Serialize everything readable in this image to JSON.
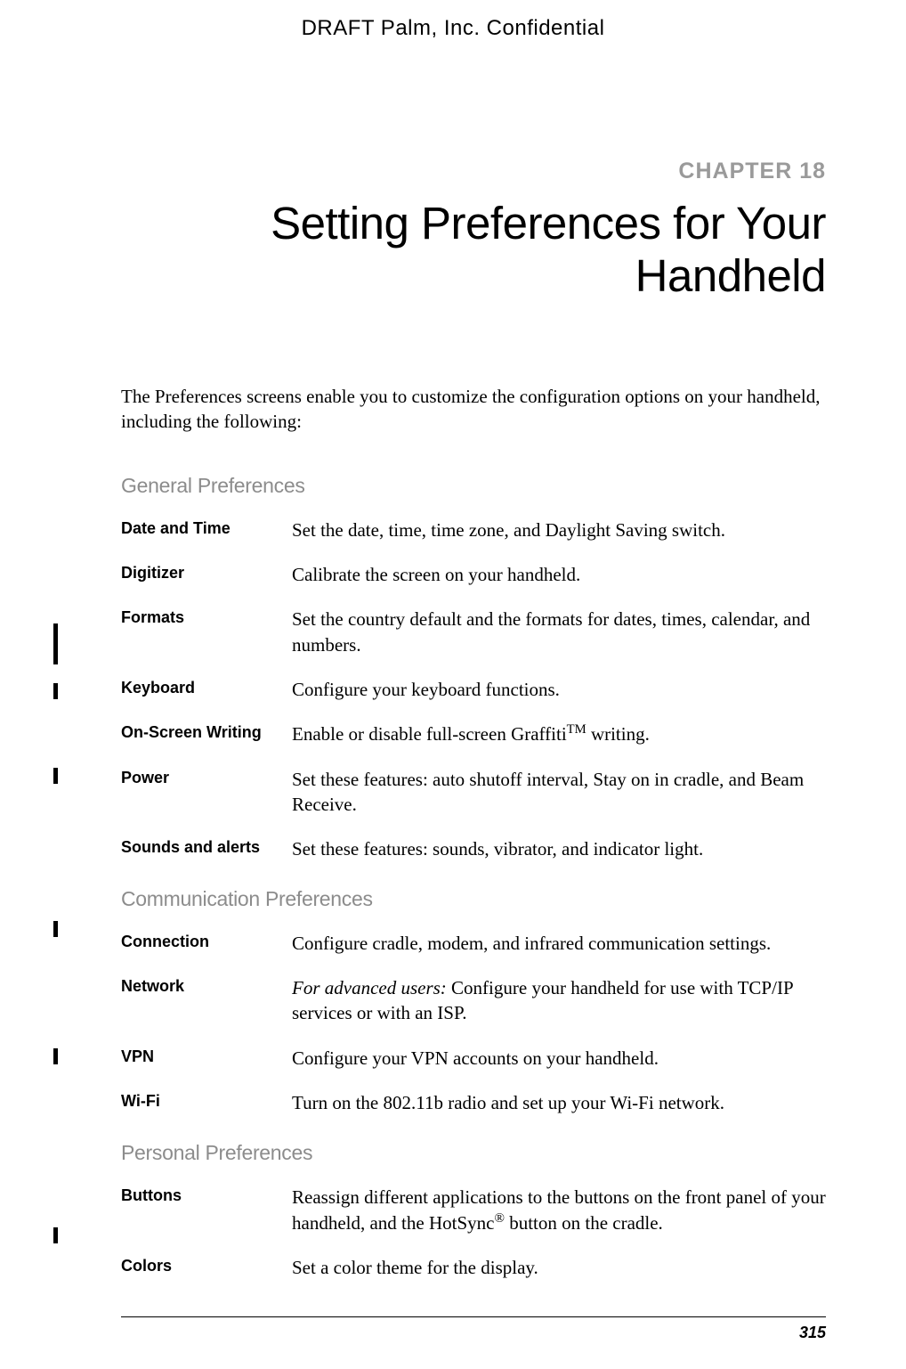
{
  "header": {
    "watermark": "DRAFT   Palm, Inc. Confidential"
  },
  "chapter": {
    "label": "CHAPTER 18",
    "title": "Setting Preferences for Your Handheld"
  },
  "intro": "The Preferences screens enable you to customize the configuration options on your handheld, including the following:",
  "sections": {
    "general": {
      "heading": "General Preferences",
      "items": [
        {
          "term": "Date and Time",
          "desc": "Set the date, time, time zone, and Daylight Saving switch."
        },
        {
          "term": "Digitizer",
          "desc": "Calibrate the screen on your handheld."
        },
        {
          "term": "Formats",
          "desc": "Set the country default and the formats for dates, times, calendar, and numbers."
        },
        {
          "term": "Keyboard",
          "desc": "Configure your keyboard functions."
        },
        {
          "term": "On-Screen Writing",
          "desc_pre": "Enable or disable full-screen Graffiti",
          "desc_tm": "TM",
          "desc_post": " writing."
        },
        {
          "term": "Power",
          "desc": "Set these features: auto shutoff interval, Stay on in cradle, and Beam Receive."
        },
        {
          "term": "Sounds and alerts",
          "desc": "Set these features: sounds, vibrator, and indicator light."
        }
      ]
    },
    "communication": {
      "heading": "Communication Preferences",
      "items": [
        {
          "term": "Connection",
          "desc": "Configure cradle, modem, and infrared communication settings."
        },
        {
          "term": "Network",
          "desc_italic": "For advanced users:",
          "desc_rest": " Configure your handheld for use with TCP/IP services or with an ISP."
        },
        {
          "term": "VPN",
          "desc": "Configure your VPN accounts on your handheld."
        },
        {
          "term": "Wi-Fi",
          "desc": "Turn on the 802.11b radio and set up your Wi-Fi network."
        }
      ]
    },
    "personal": {
      "heading": "Personal Preferences",
      "items": [
        {
          "term": "Buttons",
          "desc_pre": "Reassign different applications to the buttons on the front panel of your handheld, and the HotSync",
          "desc_reg": "®",
          "desc_post": " button on the cradle."
        },
        {
          "term": "Colors",
          "desc": "Set a color theme for the display."
        }
      ]
    }
  },
  "page_number": "315"
}
